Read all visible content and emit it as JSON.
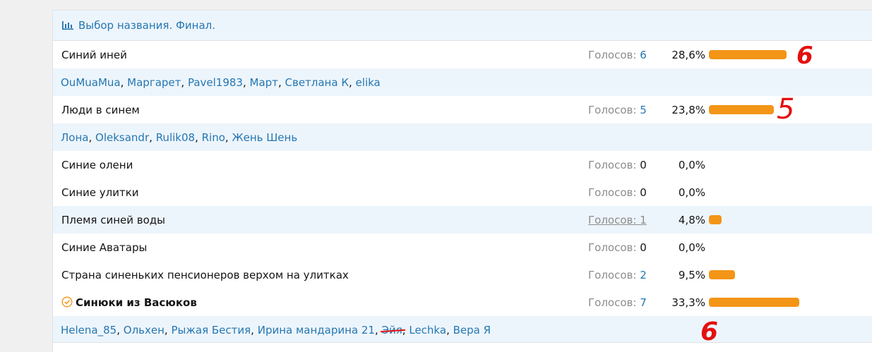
{
  "poll": {
    "title": "Выбор названия. Финал.",
    "votes_label": "Голосов:",
    "sep": ",",
    "options": [
      {
        "label": "Синий иней",
        "votes": "6",
        "pct": "28,6%",
        "fraction": 0.286
      },
      {
        "label": "Люди в синем",
        "votes": "5",
        "pct": "23,8%",
        "fraction": 0.238
      },
      {
        "label": "Синие олени",
        "votes": "0",
        "pct": "0,0%",
        "fraction": 0
      },
      {
        "label": "Синие улитки",
        "votes": "0",
        "pct": "0,0%",
        "fraction": 0
      },
      {
        "label": "Племя синей воды",
        "votes": "1",
        "pct": "4,8%",
        "fraction": 0.048
      },
      {
        "label": "Синие Аватары",
        "votes": "0",
        "pct": "0,0%",
        "fraction": 0
      },
      {
        "label": "Страна синеньких пенсионеров верхом на улитках",
        "votes": "2",
        "pct": "9,5%",
        "fraction": 0.095
      },
      {
        "label": "Синюки из Васюков",
        "votes": "7",
        "pct": "33,3%",
        "fraction": 0.333
      }
    ],
    "voters_1": [
      "OuMuaMua",
      "Маргарет",
      "Pavel1983",
      "Март",
      "Светлана К",
      "elika"
    ],
    "voters_2": [
      "Лона",
      "Oleksandr",
      "Rulik08",
      "Rino",
      "Жень Шень"
    ],
    "voters_8": [
      "Helena_85",
      "Ольхен",
      "Рыжая Бестия",
      "Ирина мандарина 21",
      "Эйя",
      "Lechka",
      "Вера Я"
    ]
  },
  "colors": {
    "accent": "#2577b1",
    "bar": "#f39517",
    "header_bg": "#edf5fc",
    "annotation": "#e41010"
  },
  "annotations": [
    "6",
    "5",
    "6"
  ]
}
